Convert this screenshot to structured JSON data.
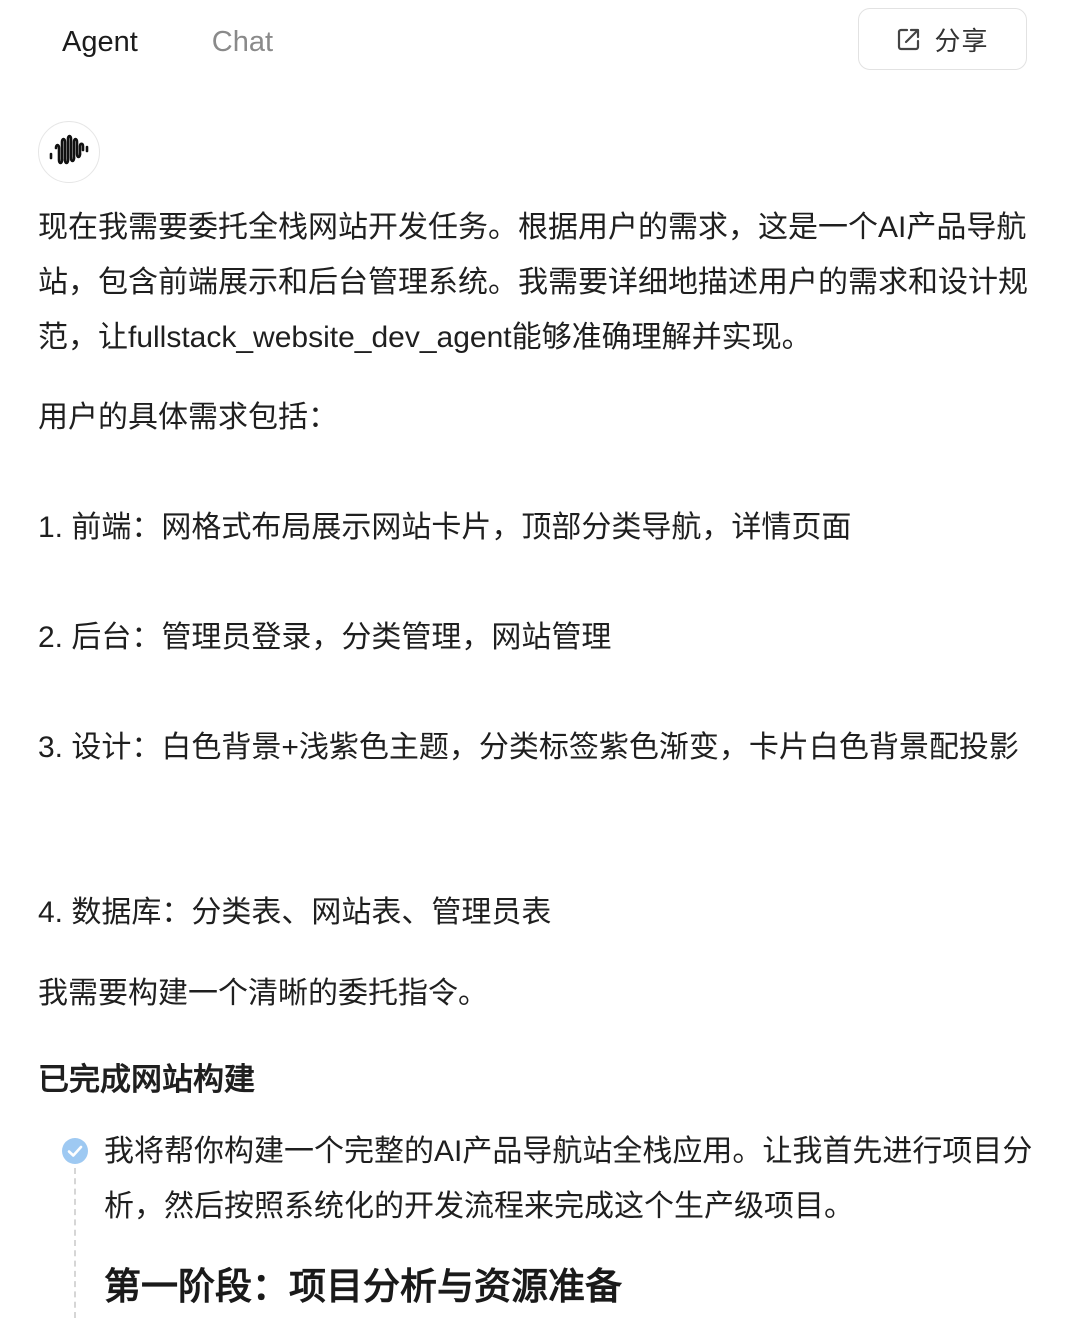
{
  "header": {
    "tabs": [
      {
        "label": "Agent",
        "active": true
      },
      {
        "label": "Chat",
        "active": false
      }
    ],
    "share_label": "分享",
    "share_icon": "share-icon"
  },
  "avatar": {
    "icon": "soundwave-logo-icon"
  },
  "message": {
    "para1": "现在我需要委托全栈网站开发任务。根据用户的需求，这是一个AI产品导航站，包含前端展示和后台管理系统。我需要详细地描述用户的需求和设计规范，让fullstack_website_dev_agent能够准确理解并实现。",
    "para2": "用户的具体需求包括：",
    "items": [
      "1. 前端：网格式布局展示网站卡片，顶部分类导航，详情页面",
      "2. 后台：管理员登录，分类管理，网站管理",
      "3. 设计：白色背景+浅紫色主题，分类标签紫色渐变，卡片白色背景配投影",
      "4. 数据库：分类表、网站表、管理员表"
    ],
    "para3": "我需要构建一个清晰的委托指令。"
  },
  "section": {
    "title": "已完成网站构建",
    "step_text": "我将帮你构建一个完整的AI产品导航站全栈应用。让我首先进行项目分析，然后按照系统化的开发流程来完成这个生产级项目。",
    "phase_title": "第一阶段：项目分析与资源准备",
    "step_icon": "check-circle-icon",
    "accent": "#9ec9f2"
  }
}
